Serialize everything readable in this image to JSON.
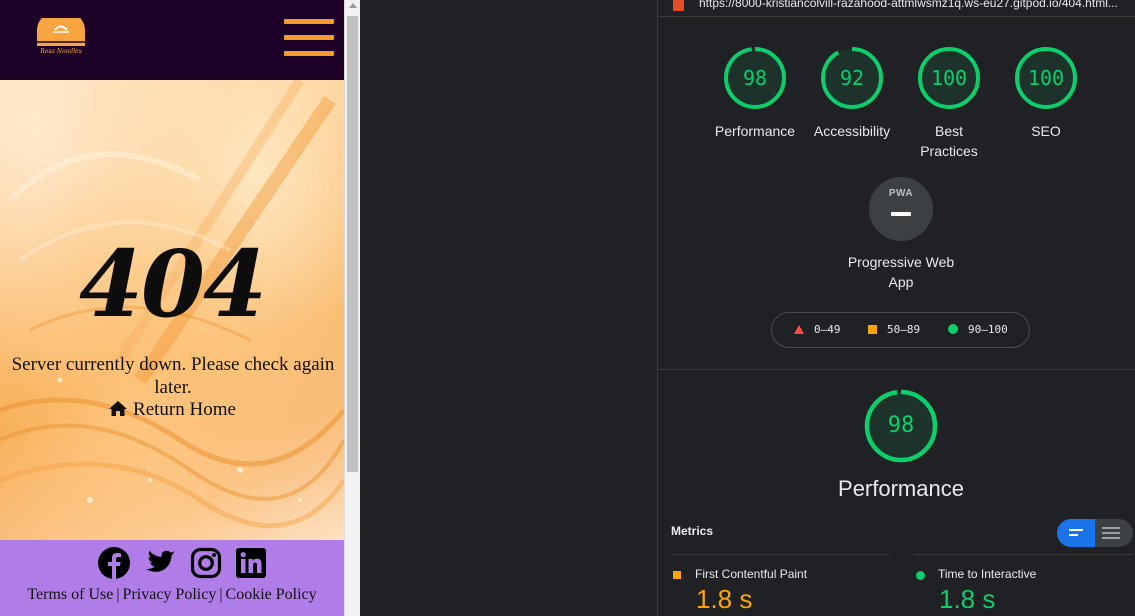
{
  "site": {
    "logo_text": "Rosa Noodles",
    "error_code": "404",
    "error_message": "Server currently down. Please check again later.",
    "return_link": "Return Home",
    "footer_links": [
      "Terms of Use",
      "Privacy Policy",
      "Cookie Policy"
    ],
    "footer_separator": "|",
    "social_icons": [
      "facebook-icon",
      "twitter-icon",
      "instagram-icon",
      "linkedin-icon"
    ],
    "colors": {
      "header_bg": "#1d0126",
      "accent": "#f59d2e",
      "footer_bg": "#b07de8"
    }
  },
  "lighthouse": {
    "url": "https://8000-kristiancolvill-razahood-attmlwsmz1q.ws-eu27.gitpod.io/404.html...",
    "categories": [
      {
        "label": "Performance",
        "score": 98
      },
      {
        "label": "Accessibility",
        "score": 92
      },
      {
        "label": "Best Practices",
        "score": 100
      },
      {
        "label": "SEO",
        "score": 100
      }
    ],
    "pwa": {
      "badge": "PWA",
      "label": "Progressive Web App"
    },
    "legend": [
      {
        "shape": "triangle",
        "range": "0–49",
        "color": "#ff4e42"
      },
      {
        "shape": "square",
        "range": "50–89",
        "color": "#ffa400"
      },
      {
        "shape": "circle",
        "range": "90–100",
        "color": "#0cce6b"
      }
    ],
    "performance": {
      "score": 98,
      "title": "Performance"
    },
    "metrics_label": "Metrics",
    "metrics": [
      {
        "name": "First Contentful Paint",
        "value": "1.8 s",
        "status": "average"
      },
      {
        "name": "Time to Interactive",
        "value": "1.8 s",
        "status": "pass"
      }
    ],
    "colors": {
      "pass": "#0cce6b",
      "average": "#ffa400",
      "fail": "#ff4e42",
      "toggle_active": "#1a73e8"
    }
  }
}
